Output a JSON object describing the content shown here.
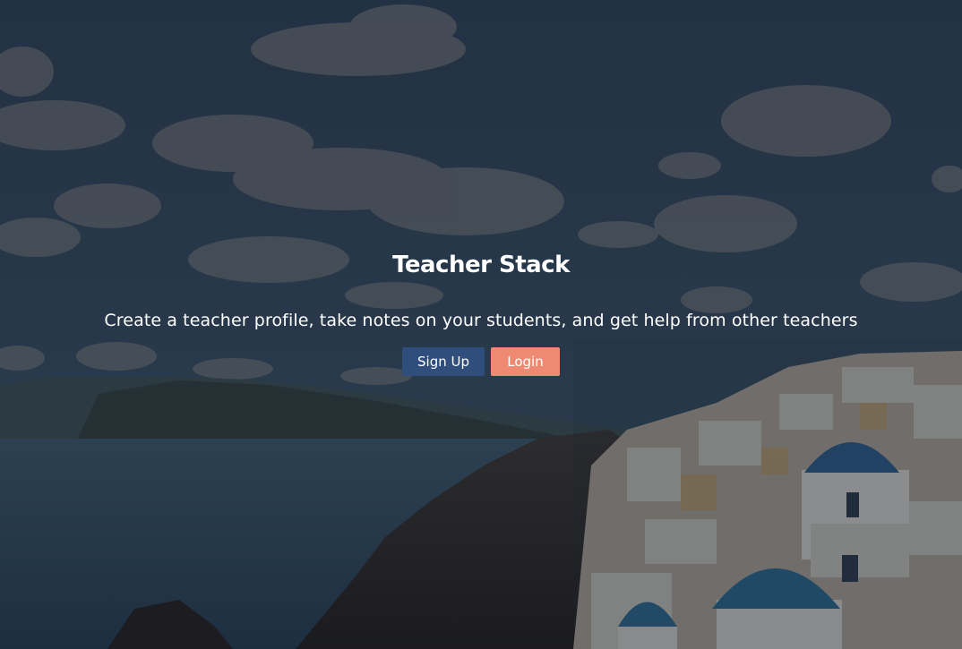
{
  "hero": {
    "title": "Teacher Stack",
    "subtitle": "Create a teacher profile, take notes on your students, and get help from other teachers"
  },
  "buttons": {
    "signup_label": "Sign Up",
    "login_label": "Login"
  },
  "colors": {
    "signup_bg": "#2f4e7c",
    "login_bg": "#ef8a72",
    "text": "#ffffff"
  }
}
